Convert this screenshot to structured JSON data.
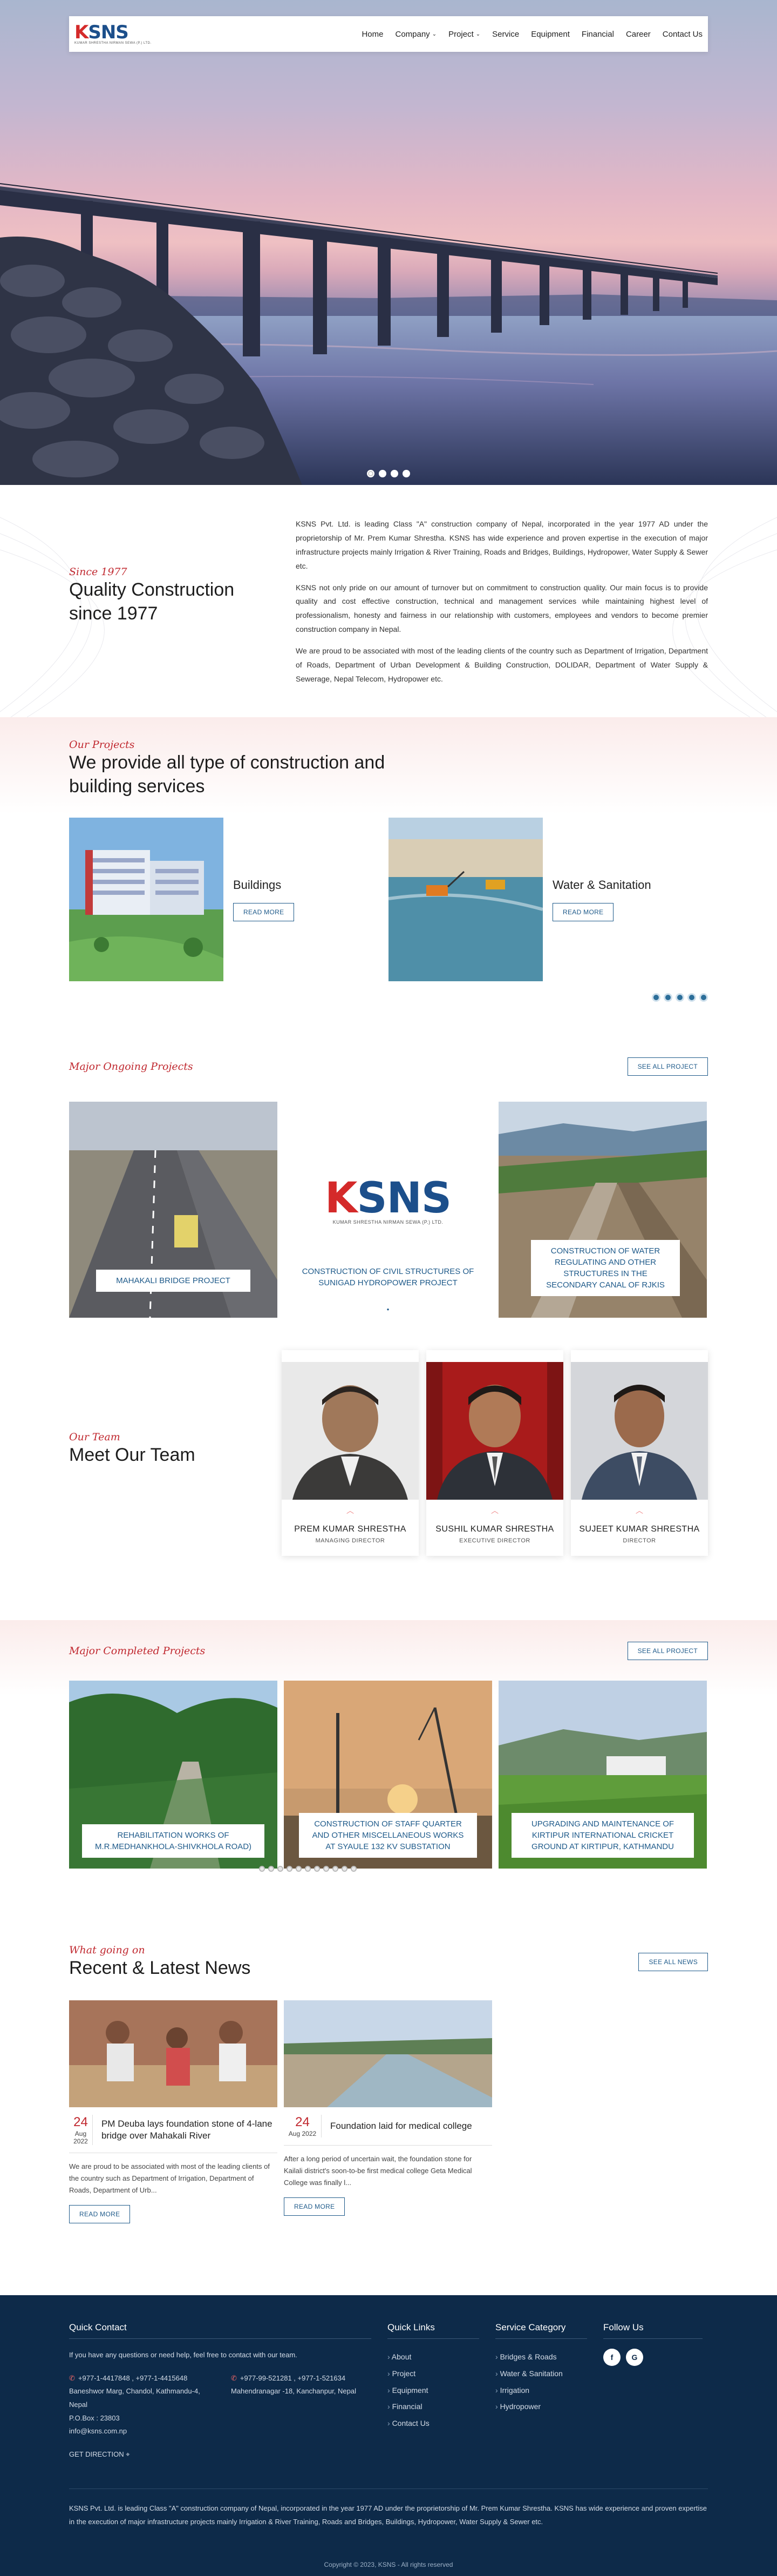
{
  "nav": {
    "logo_main_k": "K",
    "logo_main_rest": "SNS",
    "logo_sub": "KUMAR SHRESTHA NIRMAN SEWA (P.) LTD.",
    "items": [
      {
        "label": "Home",
        "dropdown": false
      },
      {
        "label": "Company",
        "dropdown": true
      },
      {
        "label": "Project",
        "dropdown": true
      },
      {
        "label": "Service",
        "dropdown": false
      },
      {
        "label": "Equipment",
        "dropdown": false
      },
      {
        "label": "Financial",
        "dropdown": false
      },
      {
        "label": "Career",
        "dropdown": false
      },
      {
        "label": "Contact Us",
        "dropdown": false
      }
    ]
  },
  "about": {
    "kicker": "Since 1977",
    "title": "Quality Construction since 1977",
    "p1": "KSNS Pvt. Ltd. is leading Class \"A\" construction company of Nepal, incorporated in the year 1977 AD under the proprietorship of Mr. Prem Kumar Shrestha. KSNS has wide experience and proven expertise in the execution of major infrastructure projects mainly Irrigation & River Training, Roads and Bridges, Buildings, Hydropower, Water Supply & Sewer etc.",
    "p2": "KSNS not only pride on our amount of turnover but on commitment to construction quality. Our main focus is to provide quality and cost effective construction, technical and management services while maintaining highest level of professionalism, honesty and fairness in our relationship with customers, employees and vendors to become premier construction company in Nepal.",
    "p3": "We are proud to be associated with most of the leading clients of the country such as Department of Irrigation, Department of Roads, Department of Urban Development & Building Construction, DOLIDAR, Department of Water Supply & Sewerage, Nepal Telecom, Hydropower etc."
  },
  "projects": {
    "kicker": "Our Projects",
    "title": "We provide all type of construction and building services",
    "cards": [
      {
        "title": "Buildings",
        "button": "READ MORE"
      },
      {
        "title": "Water & Sanitation",
        "button": "READ MORE"
      }
    ]
  },
  "ongoing": {
    "kicker": "Major Ongoing Projects",
    "button": "SEE ALL PROJECT",
    "items": [
      "MAHAKALI BRIDGE PROJECT",
      "CONSTRUCTION OF CIVIL STRUCTURES OF SUNIGAD HYDROPOWER PROJECT",
      "CONSTRUCTION OF WATER REGULATING AND OTHER STRUCTURES IN THE SECONDARY CANAL OF RJKIS"
    ],
    "logo_sub": "KUMAR SHRESTHA NIRMAN SEWA (P.) LTD."
  },
  "team": {
    "kicker": "Our Team",
    "title": "Meet Our Team",
    "members": [
      {
        "name": "PREM KUMAR SHRESTHA",
        "role": "MANAGING DIRECTOR"
      },
      {
        "name": "SUSHIL KUMAR SHRESTHA",
        "role": "EXECUTIVE DIRECTOR"
      },
      {
        "name": "SUJEET KUMAR SHRESTHA",
        "role": "DIRECTOR"
      }
    ]
  },
  "completed": {
    "kicker": "Major Completed Projects",
    "button": "SEE ALL PROJECT",
    "items": [
      "REHABILITATION WORKS OF M.R.MEDHANKHOLA-SHIVKHOLA ROAD)",
      "CONSTRUCTION OF STAFF QUARTER AND OTHER MISCELLANEOUS WORKS AT SYAULE 132 KV SUBSTATION",
      "UPGRADING AND MAINTENANCE OF KIRTIPUR INTERNATIONAL CRICKET GROUND AT KIRTIPUR, KATHMANDU"
    ]
  },
  "news": {
    "kicker": "What going on",
    "title": "Recent & Latest News",
    "button": "SEE ALL NEWS",
    "items": [
      {
        "day": "24",
        "month": "Aug 2022",
        "title": "PM Deuba lays foundation stone of 4-lane bridge over Mahakali River",
        "text": "We are proud to be associated with most of the leading clients of the country such as Department of Irrigation, Department of Roads, Department of Urb...",
        "button": "READ MORE"
      },
      {
        "day": "24",
        "month": "Aug 2022",
        "title": "Foundation laid for medical college",
        "text": "After a long period of uncertain wait, the foundation stone for Kailali district's soon-to-be first medical college Geta Medical College was finally l...",
        "button": "READ MORE"
      }
    ]
  },
  "footer": {
    "contact_title": "Quick Contact",
    "contact_intro": "If you have any questions or need help, feel free to contact with our team.",
    "phone1": "+977-1-4417848 , +977-1-4415648",
    "address1": "Baneshwor Marg, Chandol, Kathmandu-4, Nepal",
    "pobox": "P.O.Box : 23803",
    "email": "info@ksns.com.np",
    "phone2": "+977-99-521281 , +977-1-521634",
    "address2": "Mahendranagar -18, Kanchanpur, Nepal",
    "direction": "GET DIRECTION",
    "quick_title": "Quick Links",
    "quick": [
      "About",
      "Project",
      "Equipment",
      "Financial",
      "Contact Us"
    ],
    "service_title": "Service Category",
    "services": [
      "Bridges & Roads",
      "Water & Sanitation",
      "Irrigation",
      "Hydropower"
    ],
    "follow_title": "Follow Us",
    "social": [
      "f",
      "G"
    ],
    "about_text": "KSNS Pvt. Ltd. is leading Class \"A\" construction company of Nepal, incorporated in the year 1977 AD under the proprietorship of Mr. Prem Kumar Shrestha. KSNS has wide experience and proven expertise in the execution of major infrastructure projects mainly Irrigation & River Training, Roads and Bridges, Buildings, Hydropower, Water Supply & Sewer etc.",
    "copyright": "Copyright © 2023, KSNS - All rights reserved"
  },
  "colors": {
    "brand_red": "#c0282f",
    "brand_blue": "#1e5a8a",
    "footer_bg": "#0d2a49"
  }
}
